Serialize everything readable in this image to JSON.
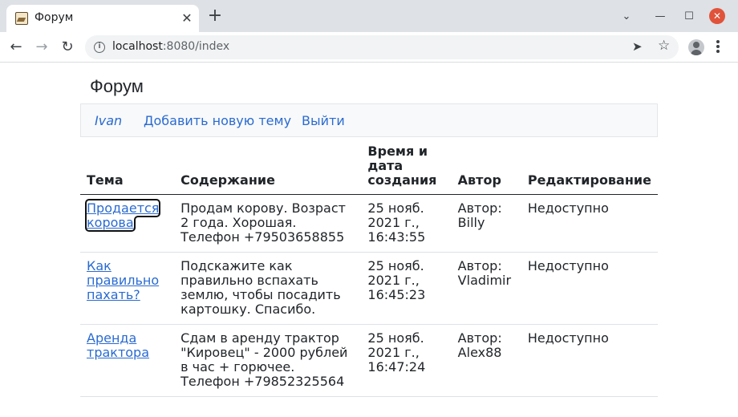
{
  "browser": {
    "tab_title": "Форум",
    "tab_close": "✕",
    "new_tab": "+",
    "url_host": "localhost",
    "url_rest": ":8080/index",
    "window_controls": {
      "dropdown": "⌄",
      "minimize": "—",
      "maximize": "☐",
      "close": "✕"
    },
    "nav": {
      "back": "←",
      "forward": "→",
      "reload": "↻"
    }
  },
  "page": {
    "title": "Форум",
    "navbar": {
      "user": "Ivan",
      "add_topic": "Добавить новую тему",
      "logout": "Выйти"
    },
    "table": {
      "headers": {
        "topic": "Тема",
        "content": "Содержание",
        "time": "Время и дата создания",
        "author": "Автор",
        "edit": "Редактирование"
      },
      "rows": [
        {
          "topic": "Продается корова",
          "content": "Продам корову. Возраст 2 года. Хорошая. Телефон +79503658855",
          "time": "25 нояб. 2021 г., 16:43:55",
          "author": "Автор: Billy",
          "edit": "Недоступно"
        },
        {
          "topic": "Как правильно пахать?",
          "content": "Подскажите как правильно вспахать землю, чтобы посадить картошку. Спасибо.",
          "time": "25 нояб. 2021 г., 16:45:23",
          "author": "Автор: Vladimir",
          "edit": "Недоступно"
        },
        {
          "topic": "Аренда трактора",
          "content": "Сдам в аренду трактор \"Кировец\" - 2000 рублей в час + горючее. Телефон +79852325564",
          "time": "25 нояб. 2021 г., 16:47:24",
          "author": "Автор: Alex88",
          "edit": "Недоступно"
        }
      ]
    }
  },
  "colors": {
    "link": "#2a6bd1",
    "navbar_bg": "#f8f9fa",
    "tabstrip_bg": "#dee1e6"
  }
}
